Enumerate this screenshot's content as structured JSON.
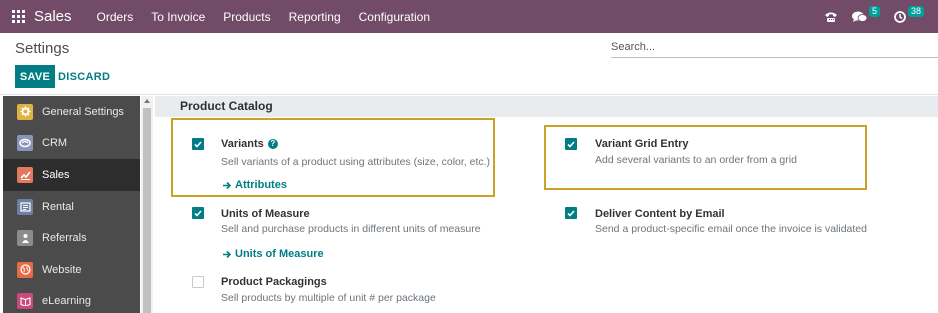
{
  "navbar": {
    "app_name": "Sales",
    "menu": [
      "Orders",
      "To Invoice",
      "Products",
      "Reporting",
      "Configuration"
    ],
    "messages_badge": "5",
    "activities_badge": "38",
    "icons": [
      "apps-grid-icon",
      "phone-icon",
      "chat-bubbles-icon",
      "clock-icon"
    ]
  },
  "control_panel": {
    "title": "Settings",
    "search_placeholder": "Search...",
    "save_label": "SAVE",
    "discard_label": "DISCARD"
  },
  "sidebar": {
    "items": [
      {
        "label": "General Settings",
        "icon": "settings-gear-icon",
        "color": "#71639e",
        "active": false
      },
      {
        "label": "CRM",
        "icon": "crm-handshake-icon",
        "color": "#5d6b8f",
        "active": false
      },
      {
        "label": "Sales",
        "icon": "sales-chart-icon",
        "color": "#d87c67",
        "active": true
      },
      {
        "label": "Rental",
        "icon": "rental-list-icon",
        "color": "#7e7e9e",
        "active": false
      },
      {
        "label": "Referrals",
        "icon": "referrals-people-icon",
        "color": "#8a8a8a",
        "active": false
      },
      {
        "label": "Website",
        "icon": "website-globe-icon",
        "color": "#e46b45",
        "active": false
      },
      {
        "label": "eLearning",
        "icon": "elearning-book-icon",
        "color": "#c94a7a",
        "active": false
      }
    ]
  },
  "section": {
    "title": "Product Catalog",
    "settings": [
      {
        "title": "Variants",
        "description": "Sell variants of a product using attributes (size, color, etc.)",
        "checked": true,
        "link": "Attributes",
        "help": "?",
        "highlighted": true
      },
      {
        "title": "Variant Grid Entry",
        "description": "Add several variants to an order from a grid",
        "checked": true,
        "highlighted": true
      },
      {
        "title": "Units of Measure",
        "description": "Sell and purchase products in different units of measure",
        "checked": true,
        "link": "Units of Measure"
      },
      {
        "title": "Deliver Content by Email",
        "description": "Send a product-specific email once the invoice is validated",
        "checked": true
      },
      {
        "title": "Product Packagings",
        "description": "Sell products by multiple of unit # per package",
        "checked": false
      }
    ]
  },
  "colors": {
    "navbar": "#714b67",
    "primary": "#017e84",
    "highlight": "#c9a227",
    "sidebar": "#4b4b4b",
    "sidebar_active": "#2d2d2d"
  }
}
